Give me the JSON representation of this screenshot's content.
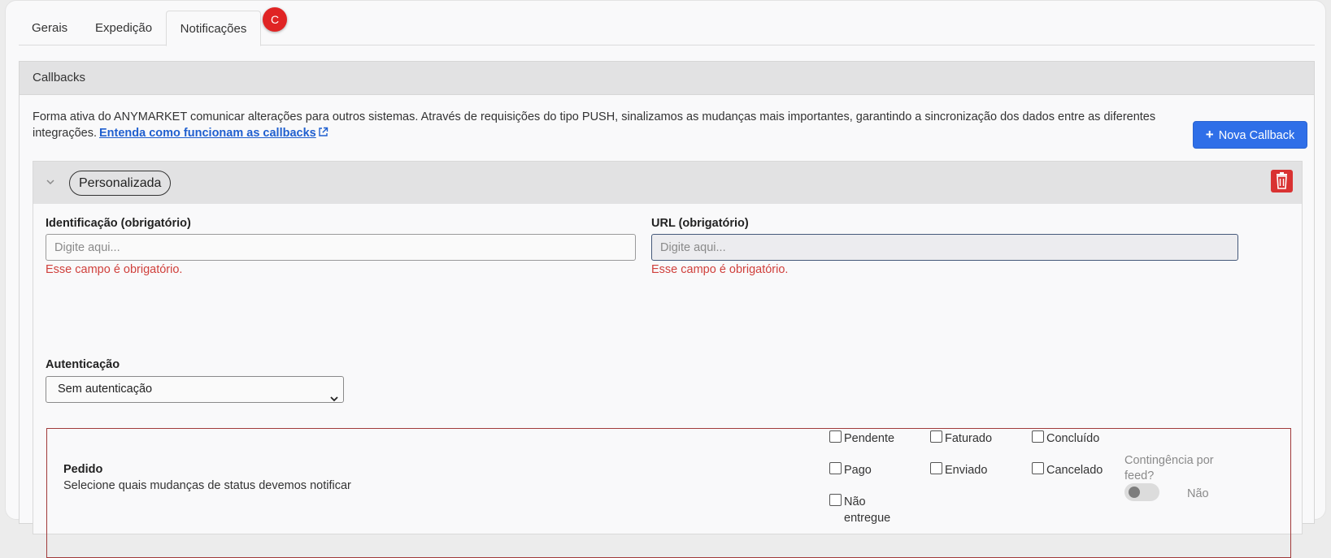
{
  "tabs": [
    {
      "label": "Gerais"
    },
    {
      "label": "Expedição"
    },
    {
      "label": "Notificações"
    }
  ],
  "tab_badge": "C",
  "section": {
    "title": "Callbacks",
    "intro_text": "Forma ativa do ANYMARKET comunicar alterações para outros sistemas. Através de requisições do tipo PUSH, sinalizamos as mudanças mais importantes, garantindo a sincronização dos dados entre as diferentes integrações.",
    "intro_link": "Entenda como funcionam as callbacks",
    "new_button_label": "Nova Callback"
  },
  "callback": {
    "name": "Personalizada",
    "identification": {
      "label": "Identificação (obrigatório)",
      "placeholder": "Digite aqui...",
      "value": "",
      "error": "Esse campo é obrigatório."
    },
    "url": {
      "label": "URL (obrigatório)",
      "placeholder": "Digite aqui...",
      "value": "",
      "error": "Esse campo é obrigatório."
    },
    "authentication": {
      "label": "Autenticação",
      "selected": "Sem autenticação"
    },
    "order": {
      "title": "Pedido",
      "subtitle": "Selecione quais mudanças de status devemos notificar",
      "statuses": [
        {
          "label": "Pendente",
          "checked": false
        },
        {
          "label": "Faturado",
          "checked": false
        },
        {
          "label": "Concluído",
          "checked": false
        },
        {
          "label": "Pago",
          "checked": false
        },
        {
          "label": "Enviado",
          "checked": false
        },
        {
          "label": "Cancelado",
          "checked": false
        },
        {
          "label": "Não entregue",
          "checked": false
        }
      ],
      "contingency": {
        "label": "Contingência por feed?",
        "value_label": "Não",
        "enabled": false
      }
    }
  },
  "colors": {
    "primary": "#2f6fe8",
    "danger": "#d93232",
    "error_text": "#d0403c",
    "link": "#1f5fcf"
  },
  "icons": {
    "collapse": "chevron-down-icon",
    "delete": "trash-icon",
    "external_link": "external-link-icon",
    "add": "plus-icon"
  }
}
